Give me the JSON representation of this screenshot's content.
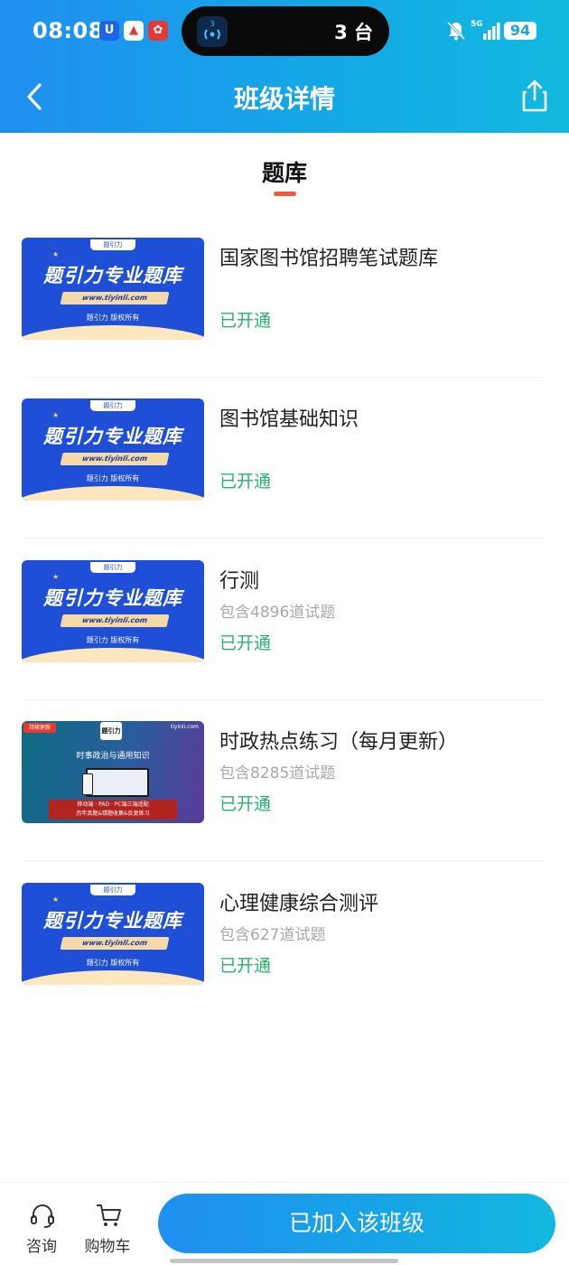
{
  "status_bar": {
    "time": "08:08",
    "island_text": "3 台",
    "island_badge": "3",
    "battery": "94",
    "network": "5G"
  },
  "nav": {
    "title": "班级详情"
  },
  "section": {
    "title": "题库"
  },
  "thumb_blue": {
    "logo": "题引力",
    "headline": "题引力专业题库",
    "url": "www.tiyinli.com",
    "sub": "题引力 版权所有"
  },
  "thumb_dark": {
    "tag": "持续更新",
    "brand": "题引力",
    "site": "tiyinli.com",
    "head": "时事政治与通用知识",
    "banner_line1": "移动端 · PAD · PC端三端适配",
    "banner_line2": "历年真题&错题收集&反复练习"
  },
  "items": [
    {
      "name": "国家图书馆招聘笔试题库",
      "count": "",
      "status": "已开通",
      "thumb": "blue"
    },
    {
      "name": "图书馆基础知识",
      "count": "",
      "status": "已开通",
      "thumb": "blue"
    },
    {
      "name": "行测",
      "count": "包含4896道试题",
      "status": "已开通",
      "thumb": "blue"
    },
    {
      "name": "时政热点练习（每月更新）",
      "count": "包含8285道试题",
      "status": "已开通",
      "thumb": "dark"
    },
    {
      "name": "心理健康综合测评",
      "count": "包含627道试题",
      "status": "已开通",
      "thumb": "blue"
    }
  ],
  "bottom_bar": {
    "consult": "咨询",
    "cart": "购物车",
    "joined": "已加入该班级"
  },
  "colors": {
    "accent": "#1a9cea",
    "opened": "#29b36a",
    "underline": "#f05a3c"
  }
}
